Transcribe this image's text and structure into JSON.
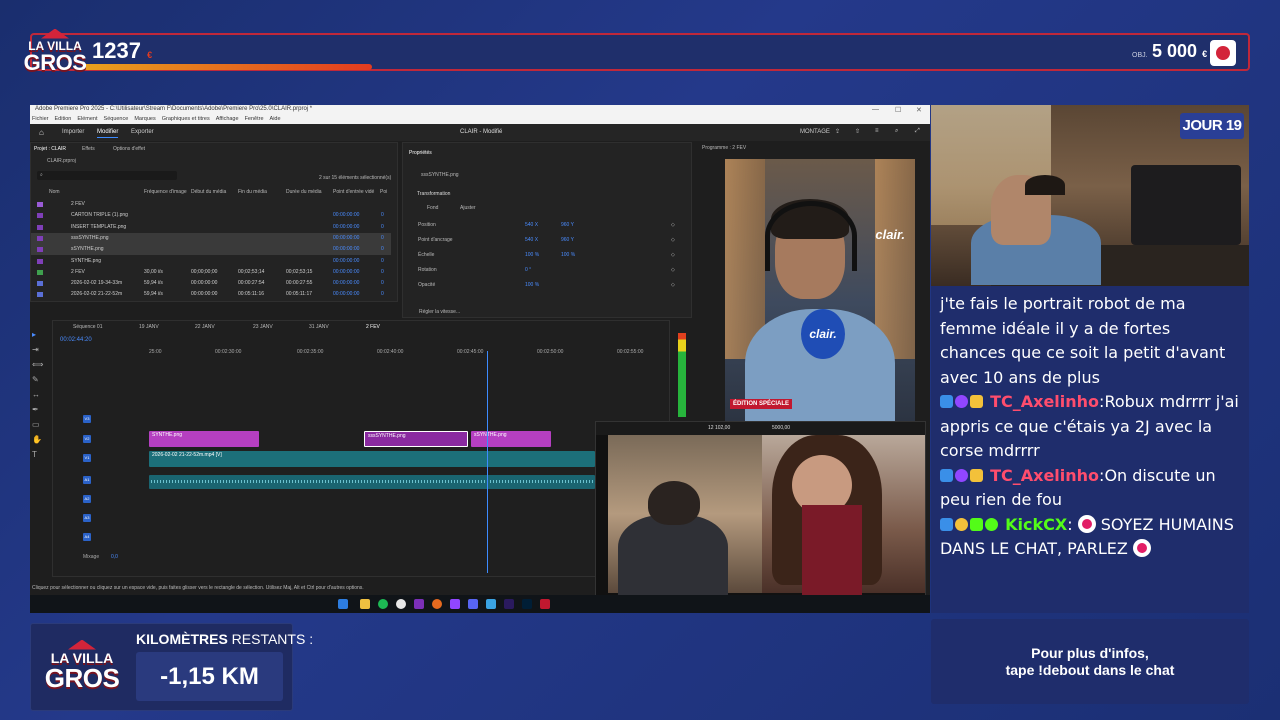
{
  "banner": {
    "logo": {
      "line1": "LA VILLA",
      "line2": "GROS"
    },
    "count": "1237",
    "count_unit": "€",
    "goal_label": "OBJ.",
    "goal": "5 000",
    "goal_unit": "€",
    "progress_fraction": 0.25
  },
  "premiere": {
    "title": "Adobe Premiere Pro 2025 - C:\\Utilisateur\\Stream F\\Documents\\Adobe\\Premiere Pro\\25.0\\CLAIR.prproj *",
    "menu": [
      "Fichier",
      "Edition",
      "Elément",
      "Séquence",
      "Marques",
      "Graphiques et titres",
      "Affichage",
      "Fenêtre",
      "Aide"
    ],
    "tabs": [
      "Importer",
      "Modifier",
      "Exporter"
    ],
    "active_tab": "Modifier",
    "doc_title": "CLAIR - Modifié",
    "workspace": "MONTAGE",
    "project_panel": {
      "tabs": [
        "Projet : CLAIR",
        "Effets",
        "Options d'effet"
      ],
      "file": "CLAIR.prproj",
      "selection": "2 sur 15 éléments sélectionné(s)",
      "columns": [
        "Nom",
        "Fréquence d'image",
        "Début du média",
        "Fin du média",
        "Durée du média",
        "Point d'entrée vidé",
        "Poi"
      ],
      "rows": [
        {
          "name": "2 FEV",
          "fps": "",
          "start": "",
          "end": "",
          "dur": "",
          "in": "",
          "x": ""
        },
        {
          "name": "CARTON TRIPLE (1).png",
          "fps": "",
          "start": "",
          "end": "",
          "dur": "",
          "in": "00:00:00:00",
          "x": "0"
        },
        {
          "name": "INSERT TEMPLATE.png",
          "fps": "",
          "start": "",
          "end": "",
          "dur": "",
          "in": "00:00:00:00",
          "x": "0"
        },
        {
          "name": "sssSYNTHE.png",
          "fps": "",
          "start": "",
          "end": "",
          "dur": "",
          "in": "00:00:00:00",
          "x": "0"
        },
        {
          "name": "sSYNTHE.png",
          "fps": "",
          "start": "",
          "end": "",
          "dur": "",
          "in": "00:00:00:00",
          "x": "0"
        },
        {
          "name": "SYNTHE.png",
          "fps": "",
          "start": "",
          "end": "",
          "dur": "",
          "in": "00:00:00:00",
          "x": "0"
        },
        {
          "name": "2 FEV",
          "fps": "30,00 i/s",
          "start": "00;00;00;00",
          "end": "00;02;53;14",
          "dur": "00;02;53;15",
          "in": "00:00:00:00",
          "x": "0"
        },
        {
          "name": "2026-02-02 19-34-33m",
          "fps": "59,94 i/s",
          "start": "00:00:00:00",
          "end": "00:00:27:54",
          "dur": "00:00:27:55",
          "in": "00:00:00:00",
          "x": "0"
        },
        {
          "name": "2026-02-02 21-22-52m",
          "fps": "59,94 i/s",
          "start": "00:00:00:00",
          "end": "00:05:11:16",
          "dur": "00:05:11:17",
          "in": "00:00:00:00",
          "x": "0"
        }
      ]
    },
    "properties": {
      "title": "Propriétés",
      "clip": "sssSYNTHE.png",
      "section": "Transformation",
      "fill": "Fond",
      "fit": "Ajuster",
      "rows": [
        {
          "label": "Position",
          "v1": "540 X",
          "v2": "960 Y"
        },
        {
          "label": "Point d'ancrage",
          "v1": "540 X",
          "v2": "960 Y"
        },
        {
          "label": "Échelle",
          "v1": "100 %",
          "v2": "100 %"
        },
        {
          "label": "Rotation",
          "v1": "0 °",
          "v2": ""
        },
        {
          "label": "Opacité",
          "v1": "100 %",
          "v2": ""
        }
      ],
      "speed_button": "Régler la vitesse..."
    },
    "program": {
      "label": "Programme : 2 FEV",
      "brand": "clair.",
      "mic_brand": "clair.",
      "badge": "ÉDITION SPÉCIALE"
    },
    "timeline": {
      "tabs": [
        "Séquence 01",
        "19 JANV",
        "22 JANV",
        "23 JANV",
        "31 JANV",
        "2 FEV"
      ],
      "timecode": "00:02:44:20",
      "ruler": [
        "25:00",
        "00:02:30:00",
        "00:02:35:00",
        "00:02:40:00",
        "00:02:45:00",
        "00:02:50:00",
        "00:02:55:00"
      ],
      "video_tracks": [
        "V3",
        "V2",
        "V1"
      ],
      "audio_tracks": [
        "A1",
        "A2",
        "A3",
        "A4"
      ],
      "mix_label": "Mixage",
      "mix_value": "0,0",
      "clips": [
        {
          "label": "SYNTHE.png",
          "track": "V2"
        },
        {
          "label": "sssSYNTHE.png",
          "track": "V2"
        },
        {
          "label": "sSYNTHE.png",
          "track": "V2"
        },
        {
          "label": "2026-02-02 21-22-52m.mp4 [V]",
          "track": "V1"
        }
      ]
    },
    "status": "Cliquez pour sélectionner ou cliquez sur un espace vide, puis faites glisser vers le rectangle de sélection. Utilisez Maj, Alt et Ctrl pour d'autres options.",
    "phone_counter": "12 102,00",
    "phone_goal": "5000,00"
  },
  "cam": {
    "day_badge": "JOUR 19"
  },
  "chat": {
    "messages": [
      {
        "user": "",
        "color": "#ffffff",
        "text": "j'te fais le portrait robot de ma femme idéale il y a de fortes chances que ce soit la petit d'avant avec 10 ans de plus"
      },
      {
        "user": "TC_Axelinho",
        "color": "#ff4d6d",
        "text": "Robux mdrrrr j'ai appris ce que c'étais ya 2J avec la corse mdrrrr"
      },
      {
        "user": "TC_Axelinho",
        "color": "#ff4d6d",
        "text": "On discute un peu rien de fou"
      },
      {
        "user": "KickCX",
        "color": "#53fc18",
        "text": "SOYEZ HUMAINS DANS LE CHAT, PARLEZ"
      }
    ]
  },
  "km": {
    "logo": {
      "line1": "LA VILLA",
      "line2": "GROS"
    },
    "label_bold": "KILOMÈTRES",
    "label_rest": " RESTANTS :",
    "value": "-1,15 KM"
  },
  "info": {
    "line1": "Pour plus d'infos,",
    "line2": "tape !debout dans le chat"
  }
}
